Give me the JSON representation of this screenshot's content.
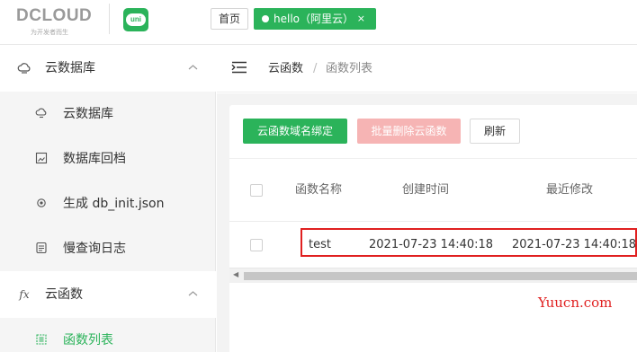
{
  "header": {
    "brand": "DCLOUD",
    "slogan": "为开发者而生",
    "uni_logo_text": "uni",
    "tabs": [
      {
        "label": "首页"
      },
      {
        "label": "hello（阿里云）",
        "close": "×"
      }
    ]
  },
  "sidebar": {
    "groups": [
      {
        "label": "云数据库",
        "icon": "cloud-database-icon",
        "items": [
          {
            "label": "云数据库",
            "icon": "cloud-icon"
          },
          {
            "label": "数据库回档",
            "icon": "image-icon"
          },
          {
            "label": "生成 db_init.json",
            "icon": "gear-icon"
          },
          {
            "label": "慢查询日志",
            "icon": "log-icon"
          }
        ]
      },
      {
        "label": "云函数",
        "icon": "fx-icon",
        "glyph": "fx",
        "items": [
          {
            "label": "函数列表",
            "icon": "list-icon",
            "active": true
          }
        ]
      }
    ]
  },
  "breadcrumb": {
    "items": [
      "云函数",
      "函数列表"
    ],
    "separator": "/"
  },
  "toolbar": {
    "bind_label": "云函数域名绑定",
    "delete_label": "批量删除云函数",
    "refresh_label": "刷新"
  },
  "table": {
    "columns": [
      "函数名称",
      "创建时间",
      "最近修改"
    ],
    "rows": [
      {
        "name": "test",
        "created": "2021-07-23 14:40:18",
        "modified": "2021-07-23 14:40:18"
      }
    ]
  },
  "watermark": "Yuucn.com",
  "colors": {
    "accent": "#2bb35a",
    "danger_light": "#f6b4b4",
    "highlight": "#e02020"
  }
}
